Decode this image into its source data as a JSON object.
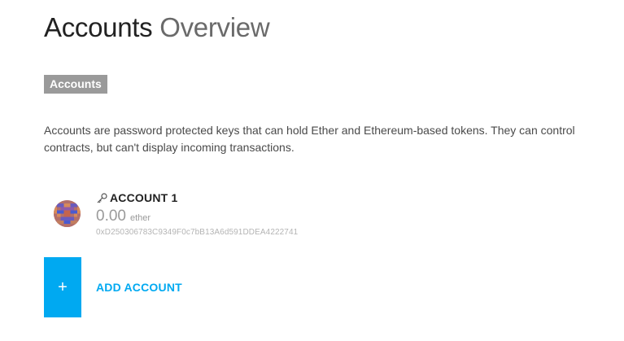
{
  "header": {
    "title_strong": "Accounts",
    "title_light": "Overview"
  },
  "section": {
    "badge": "Accounts",
    "description": "Accounts are password protected keys that can hold Ether and Ethereum-based tokens. They can control contracts, but can't display incoming transactions."
  },
  "accounts": [
    {
      "name": "ACCOUNT 1",
      "balance": "0.00",
      "unit": "ether",
      "address": "0xD250306783C9349F0c7bB13A6d591DDEA4222741",
      "icon": "key-icon"
    }
  ],
  "actions": {
    "add_symbol": "+",
    "add_label": "ADD ACCOUNT"
  },
  "colors": {
    "accent": "#00a9f1",
    "badge_bg": "#9a9a9a",
    "muted_text": "#9a9a9a"
  }
}
